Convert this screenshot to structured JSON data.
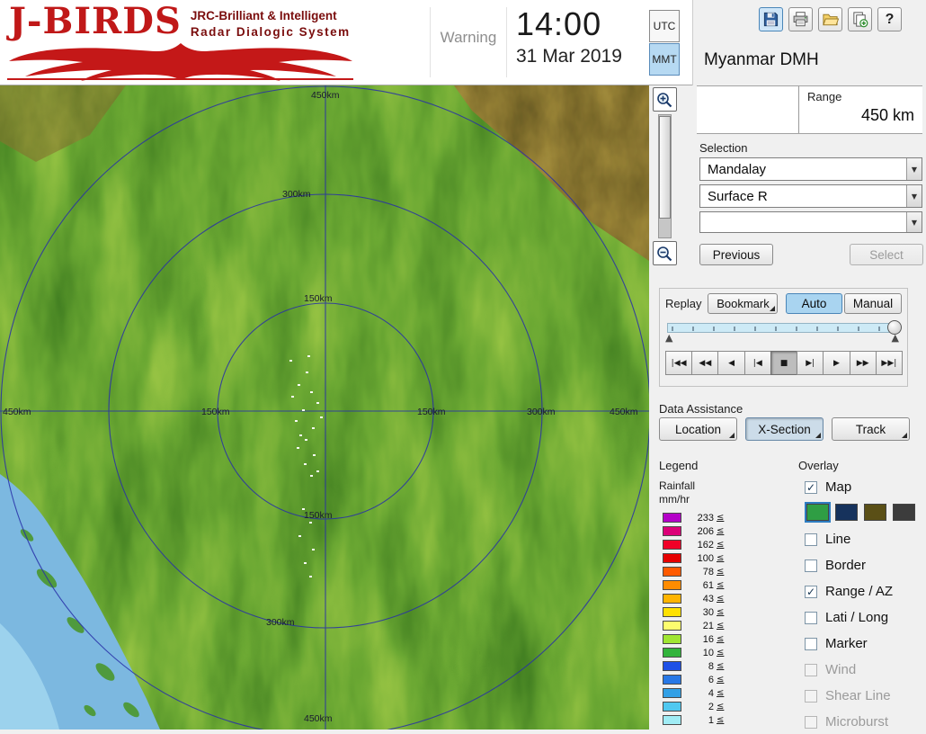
{
  "header": {
    "logo": {
      "title": "J-BIRDS",
      "subtitle_line1": "JRC-Brilliant & Intelligent",
      "subtitle_line2": "Radar  Dialogic  System"
    },
    "warning_label": "Warning",
    "clock": {
      "time": "14:00",
      "date": "31 Mar 2019"
    },
    "timezone": {
      "utc": "UTC",
      "mmt": "MMT",
      "selected": "MMT"
    },
    "station_name": "Myanmar DMH"
  },
  "range_panel": {
    "label": "Range",
    "value": "450 km"
  },
  "selection": {
    "label": "Selection",
    "site_value": "Mandalay",
    "product_value": "Surface R",
    "extra_value": "",
    "previous_label": "Previous",
    "select_label": "Select"
  },
  "replay": {
    "label": "Replay",
    "bookmark_label": "Bookmark",
    "auto_label": "Auto",
    "manual_label": "Manual",
    "playback_buttons": [
      "|◀◀",
      "◀◀",
      "◀",
      "|◀",
      "■",
      "▶|",
      "▶",
      "▶▶",
      "▶▶|"
    ]
  },
  "data_assistance": {
    "label": "Data Assistance",
    "buttons": [
      "Location",
      "X-Section",
      "Track"
    ],
    "pressed": "X-Section"
  },
  "legend": {
    "label": "Legend",
    "unit_line1": "Rainfall",
    "unit_line2": "mm/hr",
    "le_symbol": "≤",
    "entries": [
      {
        "value": "233",
        "color": "#b400c8"
      },
      {
        "value": "206",
        "color": "#dc0078"
      },
      {
        "value": "162",
        "color": "#f00028"
      },
      {
        "value": "100",
        "color": "#e60000"
      },
      {
        "value": "78",
        "color": "#ff5a00"
      },
      {
        "value": "61",
        "color": "#ff8c00"
      },
      {
        "value": "43",
        "color": "#ffb400"
      },
      {
        "value": "30",
        "color": "#ffe100"
      },
      {
        "value": "21",
        "color": "#fdfd6e"
      },
      {
        "value": "16",
        "color": "#a0e632"
      },
      {
        "value": "10",
        "color": "#32b43c"
      },
      {
        "value": "8",
        "color": "#1e50e6"
      },
      {
        "value": "6",
        "color": "#2878e6"
      },
      {
        "value": "4",
        "color": "#32a0e6"
      },
      {
        "value": "2",
        "color": "#50c8f0"
      },
      {
        "value": "1",
        "color": "#a0ecf5"
      }
    ]
  },
  "overlay": {
    "label": "Overlay",
    "items": [
      {
        "label": "Map",
        "checked": true,
        "enabled": true
      },
      {
        "label": "Line",
        "checked": false,
        "enabled": true
      },
      {
        "label": "Border",
        "checked": false,
        "enabled": true
      },
      {
        "label": "Range / AZ",
        "checked": true,
        "enabled": true
      },
      {
        "label": "Lati / Long",
        "checked": false,
        "enabled": true
      },
      {
        "label": "Marker",
        "checked": false,
        "enabled": true
      },
      {
        "label": "Wind",
        "checked": false,
        "enabled": false
      },
      {
        "label": "Shear Line",
        "checked": false,
        "enabled": false
      },
      {
        "label": "Microburst",
        "checked": false,
        "enabled": false
      }
    ],
    "map_styles": [
      "#2f9e44",
      "#16325c",
      "#5a4f16",
      "#3c3c3c"
    ],
    "selected_map_style": 0
  },
  "map": {
    "ring_labels_vertical": [
      "450km",
      "300km",
      "150km",
      "150km",
      "300km",
      "450km"
    ],
    "ring_labels_horizontal": [
      "450km",
      "150km",
      "150km",
      "300km",
      "450km"
    ]
  },
  "ui_glyphs": {
    "dropdown_arrow": "▼",
    "check": "✓",
    "slider_marker": "▲",
    "help_glyph": "?"
  }
}
